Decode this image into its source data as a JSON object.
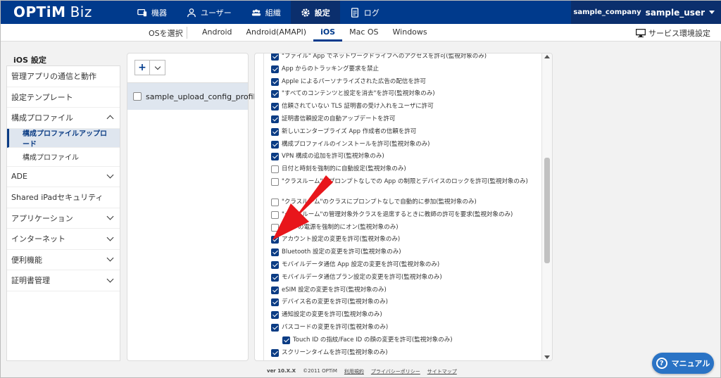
{
  "header": {
    "logo": "OPTiM",
    "logo_suffix": "Biz",
    "nav": [
      {
        "label": "機器",
        "icon": "devices-icon"
      },
      {
        "label": "ユーザー",
        "icon": "user-icon"
      },
      {
        "label": "組織",
        "icon": "organization-icon"
      },
      {
        "label": "設定",
        "icon": "gear-icon"
      },
      {
        "label": "ログ",
        "icon": "log-icon"
      }
    ],
    "active_nav": "設定",
    "company": "sample_company",
    "user": "sample_user",
    "bg_color": "#003a8c"
  },
  "os_bar": {
    "select_label": "OSを選択",
    "tabs": [
      "Android",
      "Android(AMAPI)",
      "iOS",
      "Mac OS",
      "Windows"
    ],
    "active_tab": "iOS",
    "service_settings": "サービス環境設定"
  },
  "sidebar": {
    "title": "iOS 設定",
    "items": [
      {
        "label": "管理アプリの通信と動作"
      },
      {
        "label": "設定テンプレート"
      },
      {
        "label": "構成プロファイル"
      },
      {
        "label": "構成プロファイルアップロード"
      },
      {
        "label": "構成プロファイル"
      },
      {
        "label": "ADE"
      },
      {
        "label": "Shared iPadセキュリティ"
      },
      {
        "label": "アプリケーション"
      },
      {
        "label": "インターネット"
      },
      {
        "label": "便利機能"
      },
      {
        "label": "証明書管理"
      }
    ]
  },
  "profiles": {
    "add_button": "+",
    "items": [
      "sample_upload_config_profile"
    ]
  },
  "options": [
    {
      "label": "\"ファイル\" App でネットワークドライブへのアクセスを許可(監視対象のみ)",
      "checked": true
    },
    {
      "label": "App からのトラッキング要求を禁止",
      "checked": true
    },
    {
      "label": "Apple によるパーソナライズされた広告の配信を許可",
      "checked": true
    },
    {
      "label": "\"すべてのコンテンツと設定を消去\"を許可(監視対象のみ)",
      "checked": true
    },
    {
      "label": "信頼されていない TLS 証明書の受け入れをユーザに許可",
      "checked": true
    },
    {
      "label": "証明書信頼設定の自動アップデートを許可",
      "checked": true
    },
    {
      "label": "新しいエンタープライズ App 作成者の信頼を許可",
      "checked": true
    },
    {
      "label": "構成プロファイルのインストールを許可(監視対象のみ)",
      "checked": true
    },
    {
      "label": "VPN 構成の追加を許可(監視対象のみ)",
      "checked": true
    },
    {
      "label": "日付と時刻を強制的に自動設定(監視対象のみ)",
      "checked": false
    },
    {
      "label": "\"クラスルーム\"にプロンプトなしでの App の制限とデバイスのロックを許可(監視対象のみ)",
      "checked": false
    },
    {
      "label": "\"クラスルーム\"のクラスにプロンプトなしで自動的に参加(監視対象のみ)",
      "checked": false
    },
    {
      "label": "\"クラスルーム\"の管理対象外クラスを退席するときに教師の許可を要求(監視対象のみ)",
      "checked": false
    },
    {
      "label": "Wi-Fi の電源を強制的にオン(監視対象のみ)",
      "checked": false
    },
    {
      "label": "アカウント設定の変更を許可(監視対象のみ)",
      "checked": true
    },
    {
      "label": "Bluetooth 設定の変更を許可(監視対象のみ)",
      "checked": true
    },
    {
      "label": "モバイルデータ通信 App 設定の変更を許可(監視対象のみ)",
      "checked": true
    },
    {
      "label": "モバイルデータ通信プラン設定の変更を許可(監視対象のみ)",
      "checked": true
    },
    {
      "label": "eSIM 設定の変更を許可(監視対象のみ)",
      "checked": true
    },
    {
      "label": "デバイス名の変更を許可(監視対象のみ)",
      "checked": true
    },
    {
      "label": "通知設定の変更を許可(監視対象のみ)",
      "checked": true
    },
    {
      "label": "パスコードの変更を許可(監視対象のみ)",
      "checked": true
    },
    {
      "label": "Touch ID の指紋/Face ID の顔の変更を許可(監視対象のみ)",
      "checked": true
    },
    {
      "label": "スクリーンタイムを許可(監視対象のみ)",
      "checked": true
    }
  ],
  "footer": {
    "version": "ver 10.X.X",
    "copyright": "©2011 OPTiM",
    "links": [
      "利用規約",
      "プライバシーポリシー",
      "サイトマップ"
    ]
  },
  "manual_button": "マニュアル",
  "arrow_color": "#e8161b"
}
